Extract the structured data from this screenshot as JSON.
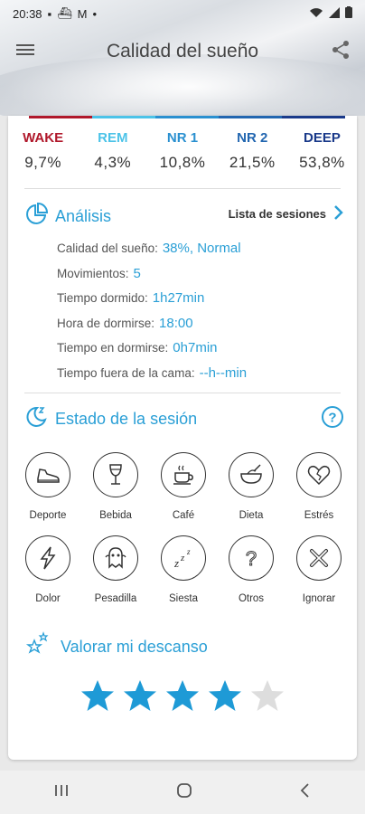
{
  "status_bar": {
    "time": "20:38"
  },
  "app": {
    "title": "Calidad del sueño"
  },
  "stages": [
    {
      "name": "WAKE",
      "percent": "9,7%",
      "color": "#b0182b"
    },
    {
      "name": "REM",
      "percent": "4,3%",
      "color": "#4cc3e8"
    },
    {
      "name": "NR 1",
      "percent": "10,8%",
      "color": "#2a90d0"
    },
    {
      "name": "NR 2",
      "percent": "21,5%",
      "color": "#2266b0"
    },
    {
      "name": "DEEP",
      "percent": "53,8%",
      "color": "#1a3a8a"
    }
  ],
  "analysis": {
    "title": "Análisis",
    "session_list_label": "Lista de sesiones",
    "rows": [
      {
        "label": "Calidad del sueño:",
        "value": "38%, Normal"
      },
      {
        "label": "Movimientos:",
        "value": "5"
      },
      {
        "label": "Tiempo dormido:",
        "value": "1h27min"
      },
      {
        "label": "Hora de dormirse:",
        "value": "18:00"
      },
      {
        "label": "Tiempo en dormirse:",
        "value": "0h7min"
      },
      {
        "label": "Tiempo fuera de la cama:",
        "value": "--h--min"
      }
    ]
  },
  "session_state": {
    "title": "Estado de la sesión",
    "tiles": [
      {
        "label": "Deporte",
        "icon": "shoe-icon"
      },
      {
        "label": "Bebida",
        "icon": "wine-glass-icon"
      },
      {
        "label": "Café",
        "icon": "coffee-cup-icon"
      },
      {
        "label": "Dieta",
        "icon": "bowl-icon"
      },
      {
        "label": "Estrés",
        "icon": "broken-heart-icon"
      },
      {
        "label": "Dolor",
        "icon": "lightning-icon"
      },
      {
        "label": "Pesadilla",
        "icon": "ghost-icon"
      },
      {
        "label": "Siesta",
        "icon": "zzz-icon"
      },
      {
        "label": "Otros",
        "icon": "question-icon"
      },
      {
        "label": "Ignorar",
        "icon": "x-icon"
      }
    ]
  },
  "rating": {
    "title": "Valorar mi descanso",
    "value": 4,
    "max": 5,
    "active_color": "#1e9ad6",
    "inactive_color": "#dddddd"
  },
  "accent_color": "#2a9fd6"
}
